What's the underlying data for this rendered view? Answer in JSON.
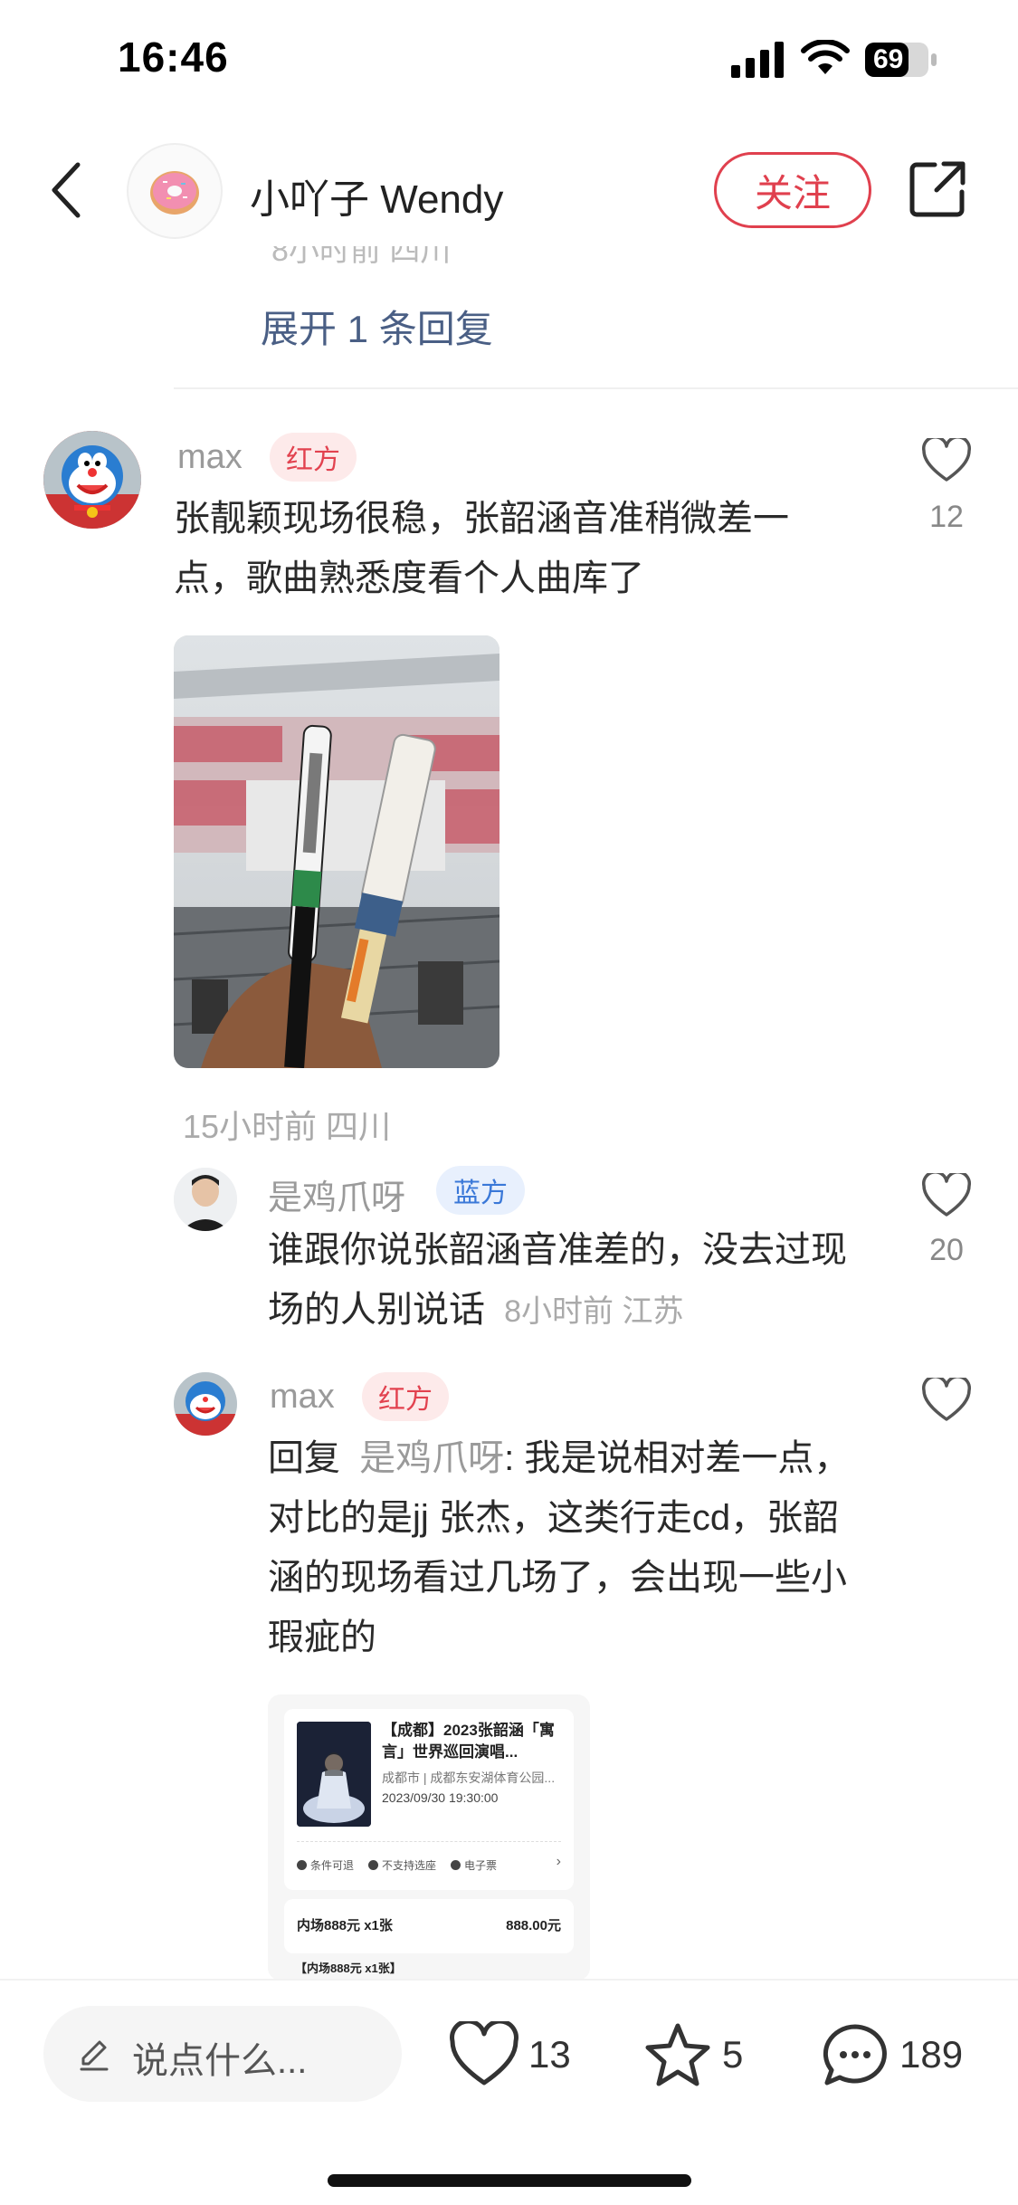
{
  "status_bar": {
    "time": "16:46",
    "battery": "69"
  },
  "header": {
    "author_name": "小吖子 Wendy",
    "follow_label": "关注"
  },
  "thread": {
    "cut_line": "8小时前 四川",
    "expand_label": "展开 1 条回复"
  },
  "comment_main": {
    "username": "max",
    "tag": "红方",
    "text": "张靓颖现场很稳，张韶涵音准稍微差一点，歌曲熟悉度看个人曲库了",
    "likes": "12",
    "meta": "15小时前 四川"
  },
  "reply_1": {
    "username": "是鸡爪呀",
    "tag": "蓝方",
    "text": "谁跟你说张韶涵音准差的，没去过现场的人别说话",
    "meta": "8小时前 江苏",
    "likes": "20"
  },
  "reply_2": {
    "username": "max",
    "tag": "红方",
    "reply_prefix": "回复",
    "reply_to": "是鸡爪呀",
    "text": ": 我是说相对差一点，对比的是jj 张杰，这类行走cd，张韶涵的现场看过几场了，会出现一些小瑕疵的"
  },
  "ticket": {
    "title": "【成都】2023张韶涵「寓言」世界巡回演唱...",
    "venue": "成都市 | 成都东安湖体育公园...",
    "datetime": "2023/09/30 19:30:00",
    "flags": [
      "条件可退",
      "不支持选座",
      "电子票"
    ],
    "seat_label": "内场888元 x1张",
    "price": "888.00元",
    "sub_label": "【内场888元 x1张】"
  },
  "bottom_bar": {
    "input_placeholder": "说点什么...",
    "likes": "13",
    "stars": "5",
    "comments": "189"
  },
  "colors": {
    "accent_red": "#e0404e",
    "link_blue": "#4a5f85",
    "tag_blue": "#3a78d8"
  }
}
